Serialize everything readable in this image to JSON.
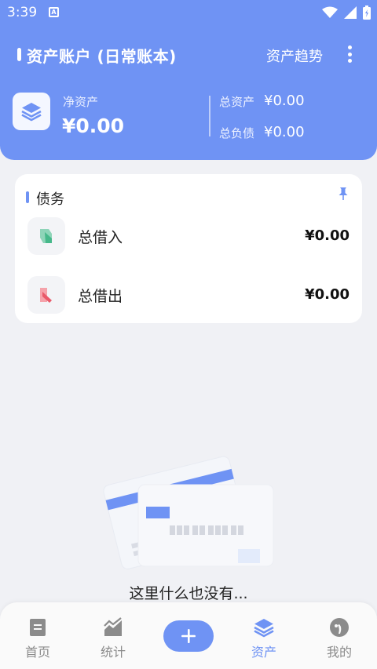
{
  "status_bar": {
    "time": "3:39",
    "notification_badge": "A"
  },
  "header": {
    "title": "资产账户 (日常账本)",
    "trend_button": "资产趋势",
    "net_assets_label": "净资产",
    "net_assets_value": "¥0.00",
    "total_assets_label": "总资产",
    "total_assets_value": "¥0.00",
    "total_liabilities_label": "总负债",
    "total_liabilities_value": "¥0.00"
  },
  "debt_card": {
    "title": "债务",
    "rows": [
      {
        "label": "总借入",
        "value": "¥0.00",
        "icon": "borrow-in-icon"
      },
      {
        "label": "总借出",
        "value": "¥0.00",
        "icon": "lend-out-icon"
      }
    ]
  },
  "empty_state": {
    "text": "这里什么也没有..."
  },
  "bottom_nav": {
    "items": [
      {
        "label": "首页",
        "icon": "home-doc-icon"
      },
      {
        "label": "统计",
        "icon": "stats-chart-icon"
      },
      {
        "label": "资产",
        "icon": "layers-icon",
        "active": true
      },
      {
        "label": "我的",
        "icon": "profile-icon"
      }
    ],
    "add_icon": "plus-icon"
  },
  "colors": {
    "accent": "#6f93f4",
    "background": "#f0f1f5",
    "nav_inactive": "#8b8b8b"
  }
}
